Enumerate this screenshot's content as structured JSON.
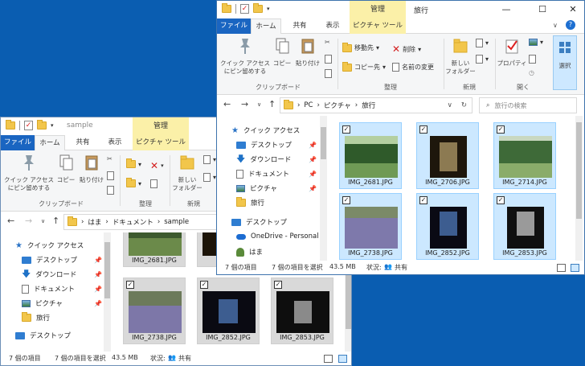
{
  "back": {
    "title": "sample",
    "context_tab_header": "管理",
    "tabs": [
      "ファイル",
      "ホーム",
      "共有",
      "表示",
      "ピクチャ ツール"
    ],
    "ribbon": {
      "pin_label": "クイック アクセス\nにピン留めする",
      "copy_label": "コピー",
      "paste_label": "貼り付け",
      "group_clipboard": "クリップボード",
      "group_organize": "整理",
      "new_folder_label": "新しい\nフォルダー",
      "group_new": "新規"
    },
    "address": [
      "はま",
      "ドキュメント",
      "sample"
    ],
    "nav": {
      "quick_access": "クイック アクセス",
      "desktop": "デスクトップ",
      "downloads": "ダウンロード",
      "documents": "ドキュメント",
      "pictures": "ピクチャ",
      "travel": "旅行",
      "desktop2": "デスクトップ"
    },
    "files": [
      "IMG_2681.JPG",
      "IMG_2738.JPG",
      "IMG_2852.JPG",
      "IMG_2853.JPG"
    ],
    "status": {
      "count": "7 個の項目",
      "selected": "7 個の項目を選択",
      "size": "43.5 MB",
      "state": "状況:",
      "shared": "共有"
    }
  },
  "front": {
    "title": "旅行",
    "context_tab_header": "管理",
    "window_controls": {
      "minimize": "—",
      "maximize": "☐",
      "close": "✕"
    },
    "tabs": [
      "ファイル",
      "ホーム",
      "共有",
      "表示",
      "ピクチャ ツール"
    ],
    "ribbon": {
      "pin_label": "クイック アクセス\nにピン留めする",
      "copy_label": "コピー",
      "paste_label": "貼り付け",
      "group_clipboard": "クリップボード",
      "move_label": "移動先",
      "delete_label": "削除",
      "copyto_label": "コピー先",
      "rename_label": "名前の変更",
      "group_organize": "整理",
      "new_folder_label": "新しい\nフォルダー",
      "group_new": "新規",
      "properties_label": "プロパティ",
      "group_open": "開く",
      "select_label": "選択"
    },
    "address": [
      "PC",
      "ピクチャ",
      "旅行"
    ],
    "search_placeholder": "旅行の検索",
    "nav": {
      "quick_access": "クイック アクセス",
      "desktop": "デスクトップ",
      "downloads": "ダウンロード",
      "documents": "ドキュメント",
      "pictures": "ピクチャ",
      "travel": "旅行",
      "desktop2": "デスクトップ",
      "onedrive": "OneDrive - Personal",
      "user": "はま"
    },
    "files": [
      "IMG_2681.JPG",
      "IMG_2706.JPG",
      "IMG_2714.JPG",
      "IMG_2738.JPG",
      "IMG_2852.JPG",
      "IMG_2853.JPG"
    ],
    "status": {
      "count": "7 個の項目",
      "selected": "7 個の項目を選択",
      "size": "43.5 MB",
      "state": "状況:",
      "shared": "共有"
    }
  },
  "colors": {
    "desktop_bg": "#0a5db1",
    "selection": "#cce8ff",
    "file_tab": "#1a65c1",
    "context_tab": "#fbf0a8"
  }
}
